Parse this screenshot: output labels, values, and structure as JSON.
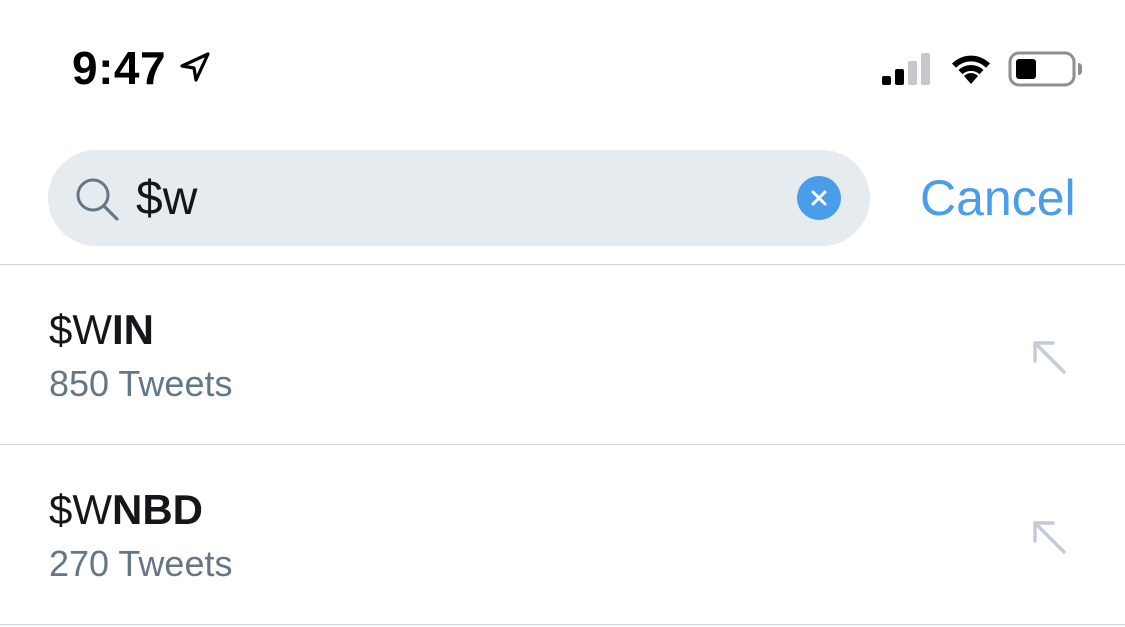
{
  "status_bar": {
    "time": "9:47",
    "icons": [
      "location-arrow-icon",
      "cellular-signal-icon",
      "wifi-icon",
      "battery-icon"
    ]
  },
  "search": {
    "query": "$w",
    "cancel_label": "Cancel",
    "icons": [
      "search-icon",
      "clear-icon"
    ]
  },
  "results": [
    {
      "title_prefix": "$W",
      "title_bold": "IN",
      "subtitle": "850 Tweets",
      "icon": "fill-search-arrow-icon"
    },
    {
      "title_prefix": "$W",
      "title_bold": "NBD",
      "subtitle": "270 Tweets",
      "icon": "fill-search-arrow-icon"
    }
  ],
  "colors": {
    "accent": "#4a9de8",
    "search_bg": "#e6ebf0",
    "primary_text": "#14171a",
    "secondary_text": "#657786",
    "divider": "#cfd4d9",
    "arrow": "#c3ccd4"
  }
}
